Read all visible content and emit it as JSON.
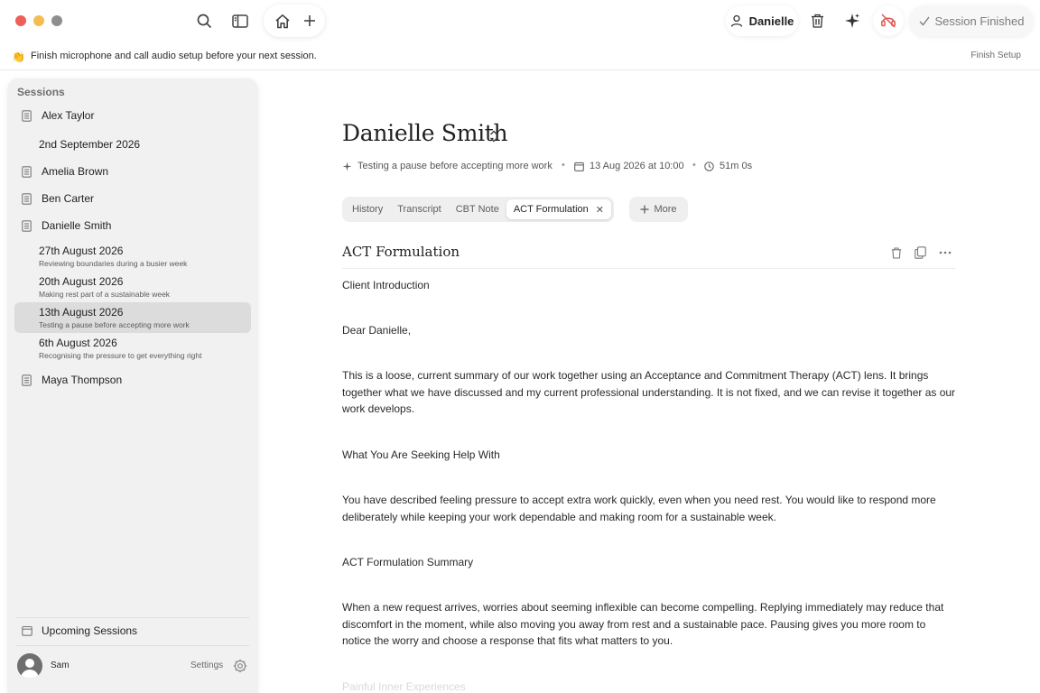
{
  "toolbar": {
    "user_name": "Danielle",
    "status_label": "Session Finished"
  },
  "banner": {
    "text": "Finish microphone and call audio setup before your next session.",
    "action": "Finish Setup"
  },
  "sidebar": {
    "title": "Sessions",
    "clients": [
      {
        "name": "Alex Taylor",
        "session": "2nd September 2026"
      },
      {
        "name": "Amelia Brown"
      },
      {
        "name": "Ben Carter"
      },
      {
        "name": "Danielle Smith",
        "sessions": [
          {
            "date": "27th August 2026",
            "summary": "Reviewing boundaries during a busier week"
          },
          {
            "date": "20th August 2026",
            "summary": "Making rest part of a sustainable week"
          },
          {
            "date": "13th August 2026",
            "summary": "Testing a pause before accepting more work"
          },
          {
            "date": "6th August 2026",
            "summary": "Recognising the pressure to get everything right"
          }
        ]
      },
      {
        "name": "Maya Thompson"
      }
    ],
    "upcoming": "Upcoming Sessions",
    "user": "Sam",
    "settings": "Settings"
  },
  "main": {
    "client_name": "Danielle Smith",
    "meta": {
      "topic": "Testing a pause before accepting more work",
      "date": "13 Aug 2026 at 10:00",
      "duration": "51m 0s"
    },
    "tabs": [
      "History",
      "Transcript",
      "CBT Note",
      "ACT Formulation"
    ],
    "more_label": "More",
    "doc_title": "ACT Formulation",
    "paragraphs": [
      "Client Introduction",
      "Dear Danielle,",
      "This is a loose, current summary of our work together using an Acceptance and Commitment Therapy (ACT) lens. It brings together what we have discussed and my current professional understanding. It is not fixed, and we can revise it together as our work develops.",
      "What You Are Seeking Help With",
      "You have described feeling pressure to accept extra work quickly, even when you need rest. You would like to respond more deliberately while keeping your work dependable and making room for a sustainable week.",
      "ACT Formulation Summary",
      "When a new request arrives, worries about seeming inflexible can become compelling. Replying immediately may reduce that discomfort in the moment, while also moving you away from rest and a sustainable pace. Pausing gives you more room to notice the worry and choose a response that fits what matters to you.",
      "Painful Inner Experiences"
    ]
  },
  "colors": {
    "close": "#ee5f57",
    "minimize": "#f5bd4f",
    "selected_row": "#dcdcdc",
    "sidebar_bg": "#f1f1f1"
  }
}
